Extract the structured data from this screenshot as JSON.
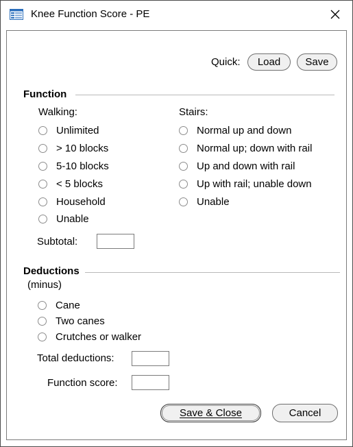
{
  "window": {
    "title": "Knee Function Score - PE",
    "close_glyph": "✕"
  },
  "quick": {
    "label": "Quick:",
    "load_label": "Load",
    "save_label": "Save"
  },
  "function_section": {
    "heading": "Function",
    "walking": {
      "label": "Walking:",
      "options": [
        "Unlimited",
        "> 10 blocks",
        "5-10 blocks",
        "< 5 blocks",
        "Household",
        "Unable"
      ]
    },
    "stairs": {
      "label": "Stairs:",
      "options": [
        "Normal up and down",
        "Normal up; down with rail",
        "Up and down with rail",
        "Up with rail; unable down",
        "Unable"
      ]
    },
    "subtotal_label": "Subtotal:",
    "subtotal_value": ""
  },
  "deductions_section": {
    "heading": "Deductions",
    "subheading": "(minus)",
    "options": [
      "Cane",
      "Two canes",
      "Crutches or walker"
    ],
    "total_label": "Total deductions:",
    "total_value": "",
    "score_label": "Function score:",
    "score_value": ""
  },
  "footer": {
    "save_close_label": "Save & Close",
    "cancel_label": "Cancel"
  },
  "colors": {
    "border": "#4a4a4a",
    "button_face": "#f0f0f0",
    "rule": "#b9b9b9"
  },
  "icons": {
    "title": "form-window-icon",
    "close": "close-icon",
    "radio": "radio-unchecked-icon"
  }
}
